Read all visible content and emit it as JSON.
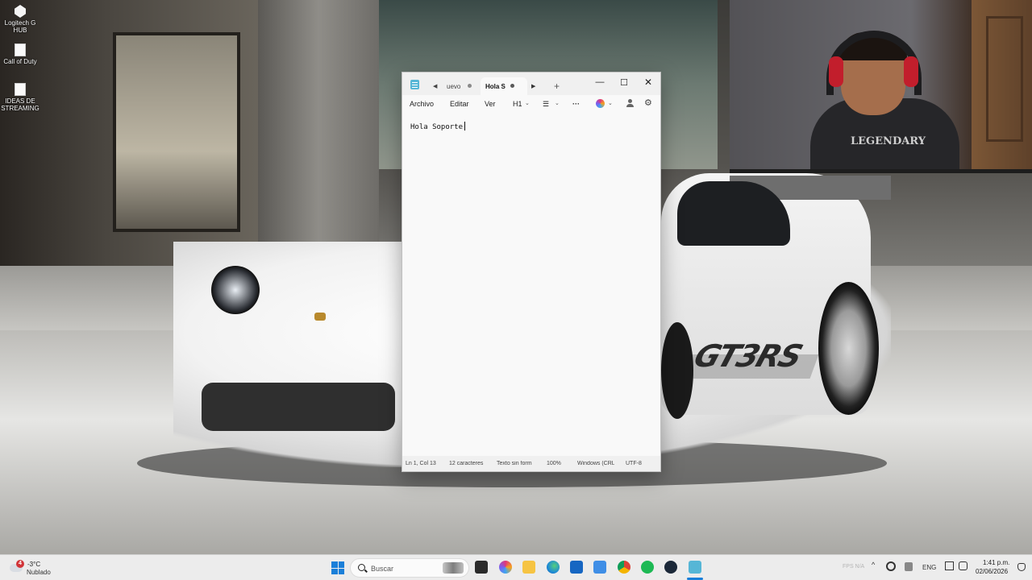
{
  "desktop": {
    "icons": [
      {
        "label": "Logitech G HUB",
        "icon": "logitech-ghub-icon"
      },
      {
        "label": "Call of Duty",
        "icon": "file-icon"
      },
      {
        "label": "IDEAS DE STREAMING",
        "icon": "file-icon"
      }
    ],
    "wallpaper": {
      "car_decal": "GT3RS",
      "shirt_text": "LEGENDARY"
    }
  },
  "notepad": {
    "tabs": [
      {
        "label": "uevo",
        "unsaved": true,
        "active": false
      },
      {
        "label": "Hola S",
        "unsaved": true,
        "active": true
      }
    ],
    "menu": {
      "file": "Archivo",
      "edit": "Editar",
      "view": "Ver",
      "heading": "H1"
    },
    "content": "Hola Soporte",
    "status": {
      "position": "Ln 1, Col 13",
      "characters": "12 caracteres",
      "format": "Texto sin formato",
      "zoom": "100%",
      "line_ending": "Windows (CRLF)",
      "encoding": "UTF-8"
    }
  },
  "taskbar": {
    "weather": {
      "temperature": "-3°C",
      "condition": "Nublado",
      "badge": "4"
    },
    "search_placeholder": "Buscar",
    "tray": {
      "faded_text": "FPS N/A",
      "language": "ENG"
    },
    "clock": {
      "time": "1:41 p.m.",
      "date": "02/06/2026"
    }
  },
  "colors": {
    "accent": "#1a7fd9",
    "notepad_icon": "#56b6d6",
    "notification_badge": "#d13438"
  }
}
